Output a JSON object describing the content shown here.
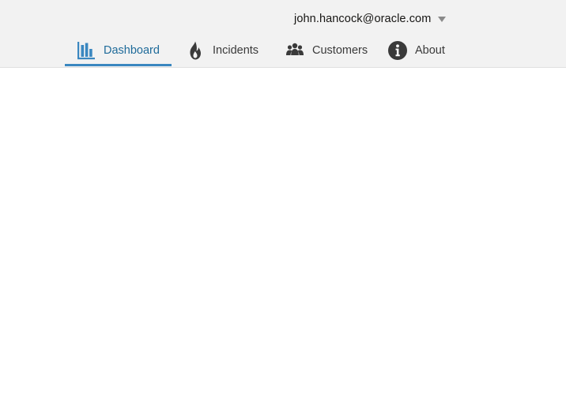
{
  "header": {
    "user": {
      "name": "john.hancock@oracle.com",
      "caret_icon": "caret-down-icon"
    }
  },
  "nav": {
    "selected": "dashboard",
    "accent_color": "#3a87c0",
    "tabs": [
      {
        "id": "dashboard",
        "label": "Dashboard",
        "icon": "bar-chart-icon"
      },
      {
        "id": "incidents",
        "label": "Incidents",
        "icon": "fire-icon"
      },
      {
        "id": "customers",
        "label": "Customers",
        "icon": "people-icon"
      },
      {
        "id": "about",
        "label": "About",
        "icon": "info-icon"
      }
    ]
  }
}
